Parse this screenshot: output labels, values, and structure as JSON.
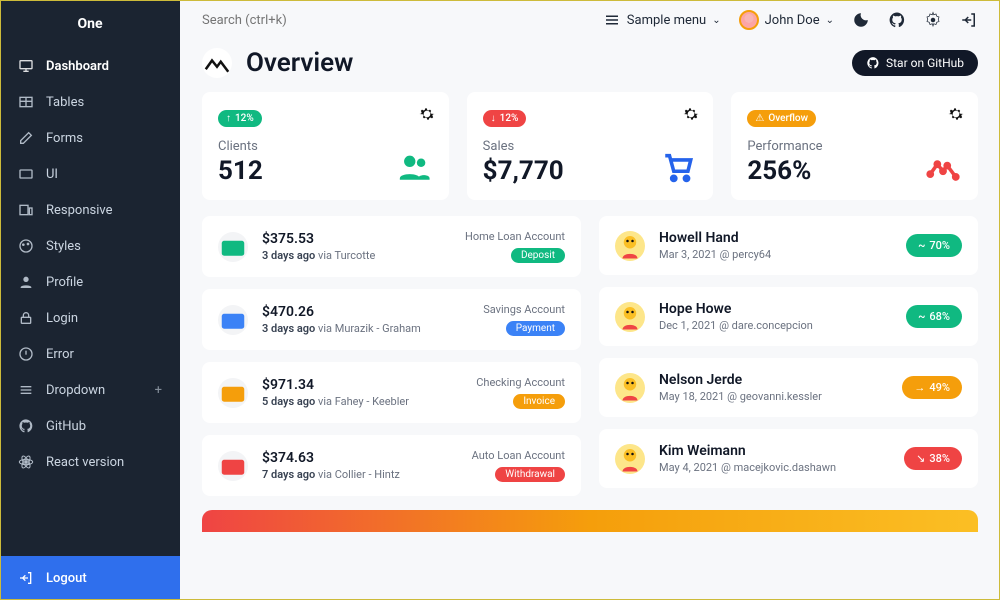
{
  "brand": "One",
  "sidebar": {
    "items": [
      {
        "label": "Dashboard",
        "icon": "monitor"
      },
      {
        "label": "Tables",
        "icon": "table"
      },
      {
        "label": "Forms",
        "icon": "edit"
      },
      {
        "label": "UI",
        "icon": "tv"
      },
      {
        "label": "Responsive",
        "icon": "responsive"
      },
      {
        "label": "Styles",
        "icon": "palette"
      },
      {
        "label": "Profile",
        "icon": "user"
      },
      {
        "label": "Login",
        "icon": "lock"
      },
      {
        "label": "Error",
        "icon": "alert"
      },
      {
        "label": "Dropdown",
        "icon": "list",
        "plus": "+"
      },
      {
        "label": "GitHub",
        "icon": "github"
      },
      {
        "label": "React version",
        "icon": "react"
      }
    ],
    "logout": "Logout"
  },
  "topbar": {
    "search_placeholder": "Search (ctrl+k)",
    "sample_menu": "Sample menu",
    "user": "John Doe"
  },
  "page": {
    "title": "Overview",
    "gh_button": "Star on GitHub"
  },
  "stats": [
    {
      "badge": "12%",
      "badge_arrow": "↑",
      "badge_color": "green",
      "label": "Clients",
      "value": "512",
      "icon": "users",
      "icon_color": "green"
    },
    {
      "badge": "12%",
      "badge_arrow": "↓",
      "badge_color": "red",
      "label": "Sales",
      "value": "$7,770",
      "icon": "cart",
      "icon_color": "blue"
    },
    {
      "badge": "Overflow",
      "badge_arrow": "⚠",
      "badge_color": "yellow",
      "label": "Performance",
      "value": "256%",
      "icon": "trend",
      "icon_color": "red"
    }
  ],
  "transactions": [
    {
      "amount": "$375.53",
      "when": "3 days ago",
      "via": " via Turcotte",
      "account": "Home Loan Account",
      "pill": "Deposit",
      "pill_color": "green",
      "icon_color": "#10b981"
    },
    {
      "amount": "$470.26",
      "when": "3 days ago",
      "via": " via Murazik - Graham",
      "account": "Savings Account",
      "pill": "Payment",
      "pill_color": "blue",
      "icon_color": "#3b82f6"
    },
    {
      "amount": "$971.34",
      "when": "5 days ago",
      "via": " via Fahey - Keebler",
      "account": "Checking Account",
      "pill": "Invoice",
      "pill_color": "yellow",
      "icon_color": "#f59e0b"
    },
    {
      "amount": "$374.63",
      "when": "7 days ago",
      "via": " via Collier - Hintz",
      "account": "Auto Loan Account",
      "pill": "Withdrawal",
      "pill_color": "red",
      "icon_color": "#ef4444"
    }
  ],
  "people": [
    {
      "name": "Howell Hand",
      "sub": "Mar 3, 2021 @ percy64",
      "pct": "70%",
      "pct_color": "green",
      "trend": "up"
    },
    {
      "name": "Hope Howe",
      "sub": "Dec 1, 2021 @ dare.concepcion",
      "pct": "68%",
      "pct_color": "green",
      "trend": "up"
    },
    {
      "name": "Nelson Jerde",
      "sub": "May 18, 2021 @ geovanni.kessler",
      "pct": "49%",
      "pct_color": "yellow",
      "trend": "flat"
    },
    {
      "name": "Kim Weimann",
      "sub": "May 4, 2021 @ macejkovic.dashawn",
      "pct": "38%",
      "pct_color": "red",
      "trend": "down"
    }
  ]
}
